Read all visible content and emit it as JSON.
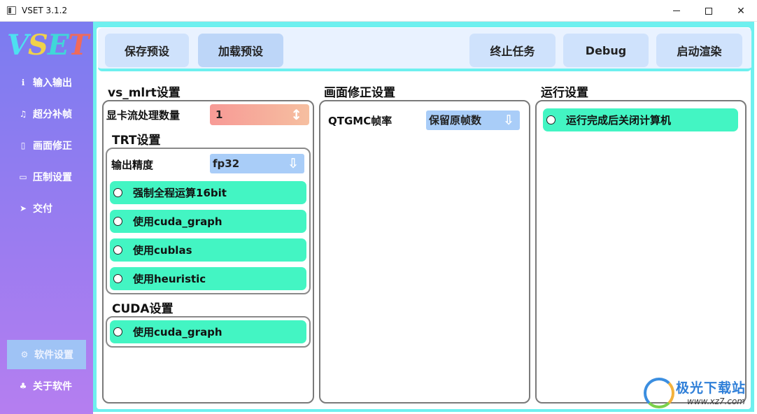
{
  "window": {
    "title": "VSET 3.1.2"
  },
  "logo": {
    "text": "VSET"
  },
  "sidebar": {
    "items": [
      {
        "label": "输入输出",
        "icon": "io-icon"
      },
      {
        "label": "超分补帧",
        "icon": "bell-icon"
      },
      {
        "label": "画面修正",
        "icon": "document-icon"
      },
      {
        "label": "压制设置",
        "icon": "monitor-icon"
      },
      {
        "label": "交付",
        "icon": "send-icon"
      },
      {
        "label": "软件设置",
        "icon": "gear-icon",
        "active": true
      },
      {
        "label": "关于软件",
        "icon": "sitemap-icon"
      }
    ]
  },
  "toolbar": {
    "save_preset": "保存预设",
    "load_preset": "加载预设",
    "stop_task": "终止任务",
    "debug": "Debug",
    "start_render": "启动渲染"
  },
  "vs_mlrt": {
    "title": "vs_mlrt设置",
    "stream_label": "显卡流处理数量",
    "stream_value": "1",
    "trt": {
      "title": "TRT设置",
      "precision_label": "输出精度",
      "precision_value": "fp32",
      "options": [
        "强制全程运算16bit",
        "使用cuda_graph",
        "使用cublas",
        "使用heuristic"
      ]
    },
    "cuda": {
      "title": "CUDA设置",
      "options": [
        "使用cuda_graph"
      ]
    }
  },
  "correction": {
    "title": "画面修正设置",
    "qtgmc_label": "QTGMC帧率",
    "qtgmc_value": "保留原帧数"
  },
  "run": {
    "title": "运行设置",
    "options": [
      "运行完成后关闭计算机"
    ]
  },
  "watermark": {
    "text": "极光下载站",
    "url": "www.xz7.com"
  },
  "colors": {
    "sidebar_top": "#7b7cf0",
    "sidebar_bottom": "#b57ef0",
    "accent_cyan": "#6ef0ef",
    "check_green": "#43f5c3",
    "select_blue": "#a9cdf8",
    "button_blue": "#cfe2fc"
  }
}
